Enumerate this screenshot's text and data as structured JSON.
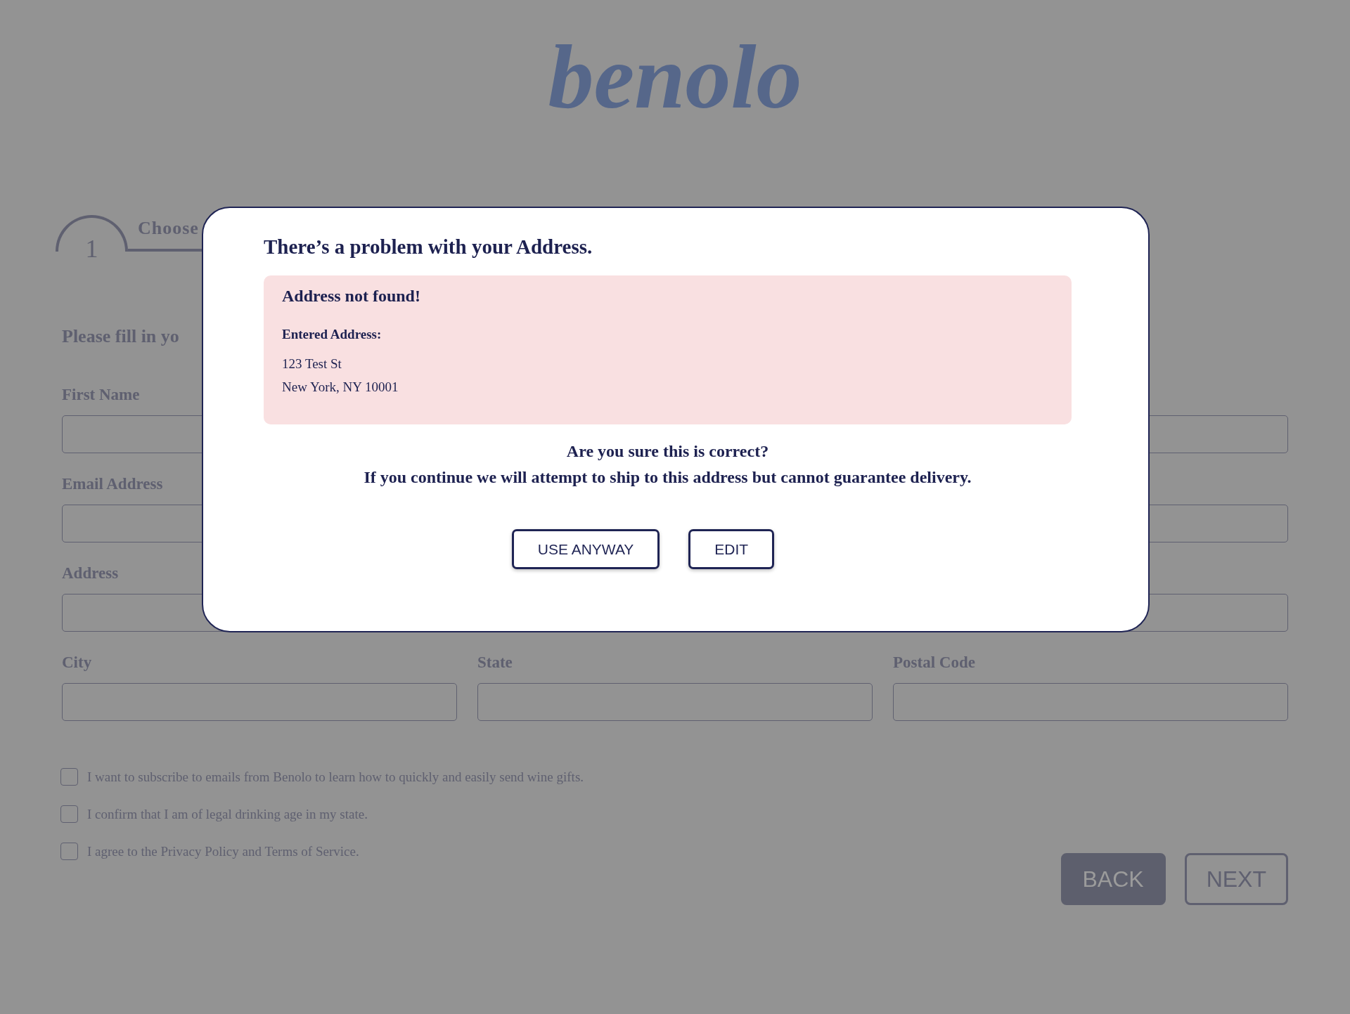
{
  "logo": {
    "text": "benolo"
  },
  "step": {
    "number": "1",
    "label": "Choose"
  },
  "form": {
    "heading": "Please fill in yo",
    "rows": [
      {
        "fields": [
          {
            "kind": "input",
            "label": "First Name"
          },
          {
            "kind": "input"
          }
        ]
      },
      {
        "fields": [
          {
            "kind": "input",
            "label": "Email Address"
          },
          {
            "kind": "input"
          }
        ]
      },
      {
        "fields": [
          {
            "kind": "input",
            "label": "Address"
          },
          {
            "kind": "input"
          }
        ]
      },
      {
        "fields": [
          {
            "kind": "input",
            "label": "City"
          },
          {
            "kind": "input",
            "label": "State"
          },
          {
            "kind": "input",
            "label": "Postal Code"
          }
        ]
      }
    ],
    "checkboxes": [
      {
        "label": "I want to subscribe to emails from Benolo to learn how to quickly and easily send wine gifts.",
        "checked": false
      },
      {
        "label": "I confirm that I am of legal drinking age in my state.",
        "checked": false
      },
      {
        "label": "I agree to the Privacy Policy and Terms of Service.",
        "checked": false
      }
    ],
    "buttons": [
      {
        "label": "BACK",
        "kind": "filled"
      },
      {
        "label": "NEXT",
        "kind": "outlined"
      }
    ]
  },
  "dialog": {
    "title": "There’s a problem with your Address.",
    "alert": {
      "heading": "Address not found!",
      "caption": "Entered Address:",
      "lines": [
        "123 Test St",
        "New York, NY 10001"
      ]
    },
    "message": [
      "Are you sure this is correct?",
      "If you continue we will attempt to ship to this address but cannot guarantee delivery."
    ],
    "buttons": [
      {
        "label": "USE ANYWAY"
      },
      {
        "label": "EDIT"
      }
    ]
  }
}
